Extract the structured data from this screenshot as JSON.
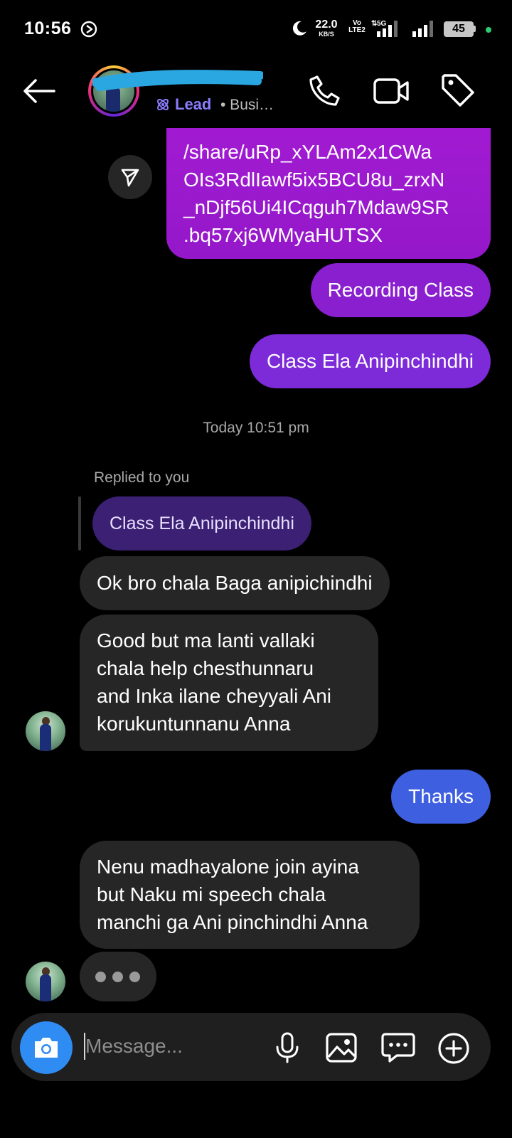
{
  "status_bar": {
    "time": "10:56",
    "net_speed_value": "22.0",
    "net_speed_unit": "KB/S",
    "volte_top": "Vo",
    "volte_bottom": "LTE2",
    "network_type": "5G",
    "battery": "45",
    "icons": [
      "dnd-icon",
      "moon-icon",
      "signal-icon",
      "battery-icon"
    ]
  },
  "header": {
    "back_icon": "arrow-left-icon",
    "name": "...",
    "lead_label": "Lead",
    "subtitle": "• Busi…",
    "icons": [
      "phone-icon",
      "video-icon",
      "tag-icon"
    ],
    "accent_color": "#8a7dff"
  },
  "messages": {
    "link_text": "/share/uRp_xYLAm2x1CWa\nOIs3RdlIawf5ix5BCU8u_zrxN\n_nDjf56Ui4ICqguh7Mdaw9SR\n.bq57xj6WMyaHUTSX",
    "recording": "Recording Class",
    "class_ela": "Class Ela Anipinchindhi",
    "timestamp": "Today 10:51 pm",
    "replied_label": "Replied to you",
    "reply_quote": "Class Ela Anipinchindhi",
    "in_1": "Ok bro chala Baga anipichindhi",
    "in_2": "Good but ma lanti vallaki\nchala help chesthunnaru\nand Inka ilane cheyyali Ani\nkorukuntunnanu Anna",
    "thanks": "Thanks",
    "in_3": "Nenu madhayalone join ayina\nbut Naku mi speech chala\nmanchi ga Ani pinchindhi Anna"
  },
  "composer": {
    "placeholder": "Message...",
    "icons": [
      "camera-icon",
      "microphone-icon",
      "gallery-icon",
      "sticker-icon",
      "plus-icon"
    ]
  },
  "colors": {
    "outgoing_purple": "#9418c9",
    "outgoing_violet": "#7d2ad8",
    "outgoing_blue": "#3e5fe0",
    "incoming": "#262626",
    "camera_blue": "#2f8cf3"
  }
}
